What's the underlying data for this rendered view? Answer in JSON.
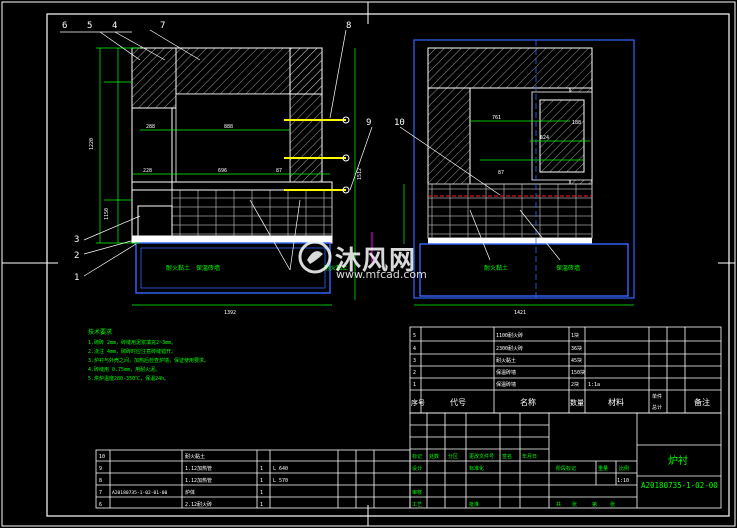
{
  "part_numbers_left": [
    "6",
    "5",
    "4",
    "7",
    "8",
    "9",
    "3",
    "2",
    "1"
  ],
  "part_number_right": "10",
  "dims_left": [
    "1220",
    "1512",
    "288",
    "888",
    "228",
    "696",
    "87",
    "1392",
    "1150"
  ],
  "dims_right": [
    "761",
    "188",
    "624",
    "1421",
    "87"
  ],
  "labels_left": [
    "耐火黏土",
    "保温砖墙",
    "耐火黏土"
  ],
  "labels_right": [
    "耐火黏土",
    "保温砖墙"
  ],
  "notes": {
    "title": "技术要求",
    "lines": [
      "1.砌砖 2mm，砖缝用泥浆填充2~3mm。",
      "2.浇注 4mm，砌砖时应注意砖缝错开。",
      "3.炉衬与外壳之间，加热后检查炉墙，保证使用要求。",
      "4.砖缝用 0.75mm，用耐火泥。",
      "5.烘炉温度280-350℃，保温24h。"
    ]
  },
  "bom_upper": {
    "rows": [
      {
        "no": "5",
        "name": "1100耐火砖",
        "material": "1块",
        "qty": ""
      },
      {
        "no": "4",
        "name": "2300耐火砖",
        "material": "36块",
        "qty": ""
      },
      {
        "no": "3",
        "name": "耐火黏土",
        "material": "45块",
        "qty": ""
      },
      {
        "no": "2",
        "name": "保温砖墙",
        "material": "150块",
        "qty": ""
      },
      {
        "no": "1",
        "name": "保温砖墙",
        "material": "2块",
        "qty": "1:1a"
      }
    ],
    "header": {
      "no": "序号",
      "code": "代号",
      "name": "名称",
      "qty": "数量",
      "material": "材料",
      "weight1": "单件",
      "weight2": "总计",
      "remark": "备注"
    }
  },
  "bom_lower": {
    "rows": [
      {
        "no": "10",
        "code": "",
        "name": "耐火黏土",
        "qty": "",
        "material": ""
      },
      {
        "no": "9",
        "code": "",
        "name": "1.12加热管",
        "qty": "1",
        "material": "L 640"
      },
      {
        "no": "8",
        "code": "",
        "name": "1.12加热管",
        "qty": "1",
        "material": "L 570"
      },
      {
        "no": "7",
        "code": "A20180735-1-02-01-00",
        "name": "炉体",
        "qty": "1",
        "material": ""
      },
      {
        "no": "6",
        "code": "",
        "name": "2.12耐火砖",
        "qty": "1",
        "material": ""
      }
    ]
  },
  "title_block": {
    "drawing_name": "炉衬",
    "drawing_number": "A20180735-1-02-00",
    "scale": "1:10",
    "cells": [
      "标记",
      "处数",
      "分区",
      "更改文件号",
      "签名",
      "年月日",
      "设计",
      "标准化",
      "阶段标记",
      "重量",
      "比例",
      "审核",
      "工艺",
      "批准",
      "共",
      "张",
      "第",
      "张"
    ]
  },
  "watermark": {
    "text": "沐风网",
    "url": "www.mfcad.com"
  },
  "colors": {
    "background": "#000000",
    "line": "#ffffff",
    "dimension": "#00ff00",
    "brick": "#c8c8c8",
    "refractory": "#ffffff",
    "blue_line": "#3366ff",
    "cyan": "#00ffff",
    "yellow": "#ffff00",
    "red": "#ff2020",
    "magenta": "#ff00ff"
  }
}
